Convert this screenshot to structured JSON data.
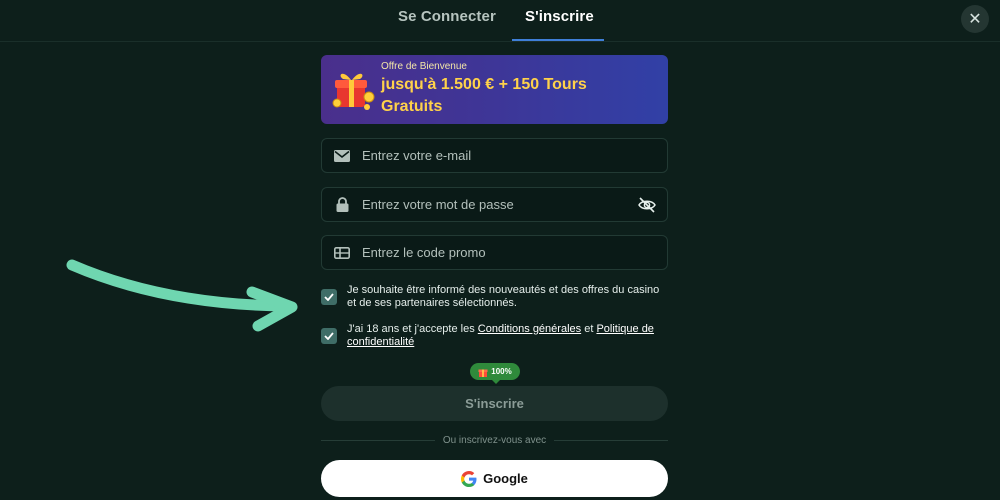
{
  "tabs": {
    "login": "Se Connecter",
    "register": "S'inscrire"
  },
  "close": {
    "icon": "close-icon",
    "glyph": "✕"
  },
  "promo": {
    "subtitle": "Offre de Bienvenue",
    "title": "jusqu'à 1.500 € + 150 Tours Gratuits",
    "icon": "gift-box-icon"
  },
  "fields": {
    "email": {
      "placeholder": "Entrez votre e-mail",
      "icon": "mail-icon"
    },
    "password": {
      "placeholder": "Entrez votre mot de passe",
      "icon": "lock-icon",
      "toggle_icon": "eye-off-icon"
    },
    "promo_code": {
      "placeholder": "Entrez le code promo",
      "icon": "ticket-icon"
    }
  },
  "checkboxes": {
    "newsletter": {
      "checked": true,
      "text": "Je souhaite être informé des nouveautés et des offres du casino et de ses partenaires sélectionnés."
    },
    "terms": {
      "checked": true,
      "prefix": "J'ai 18 ans et j'accepte les ",
      "link1": "Conditions générales",
      "middle": " et ",
      "link2": "Politique de confidentialité"
    }
  },
  "progress_badge": {
    "value": "100%",
    "icon": "gift-icon"
  },
  "submit": {
    "label": "S'inscrire"
  },
  "divider": {
    "text": "Ou inscrivez-vous avec"
  },
  "google": {
    "label": "Google",
    "icon": "google-icon"
  },
  "colors": {
    "background": "#0d1f1b",
    "promo_gradient_start": "#4a2f8c",
    "promo_gradient_end": "#3140a6",
    "promo_title": "#ffd24a",
    "checkbox": "#3f6d67",
    "arrow": "#6fd6b0",
    "badge": "#2f8a3b"
  }
}
